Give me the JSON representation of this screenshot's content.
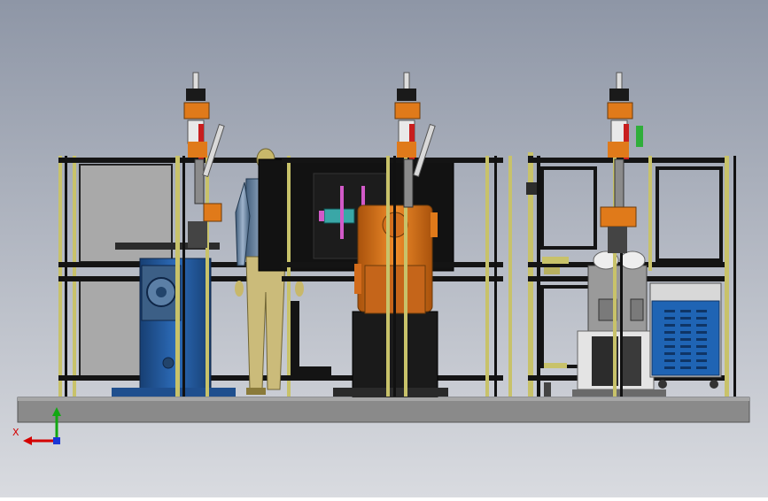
{
  "viewport": {
    "background_top": "#8e96a6",
    "background_bottom": "#d9dbe0"
  },
  "triad": {
    "x_label": "X",
    "x_color": "#d40000",
    "y_color": "#12a812",
    "z_color": "#1a37d6"
  },
  "scene": {
    "frame_color": "#141414",
    "post_color": "#c8c26a",
    "base_plate_color": "#8c8c8c",
    "robot_color": "#e07a1a",
    "positioner_color": "#1f5aa0",
    "controller_color": "#1f64b4",
    "torch_color": "#c81e1e",
    "figure_color": "#c8b86a"
  }
}
